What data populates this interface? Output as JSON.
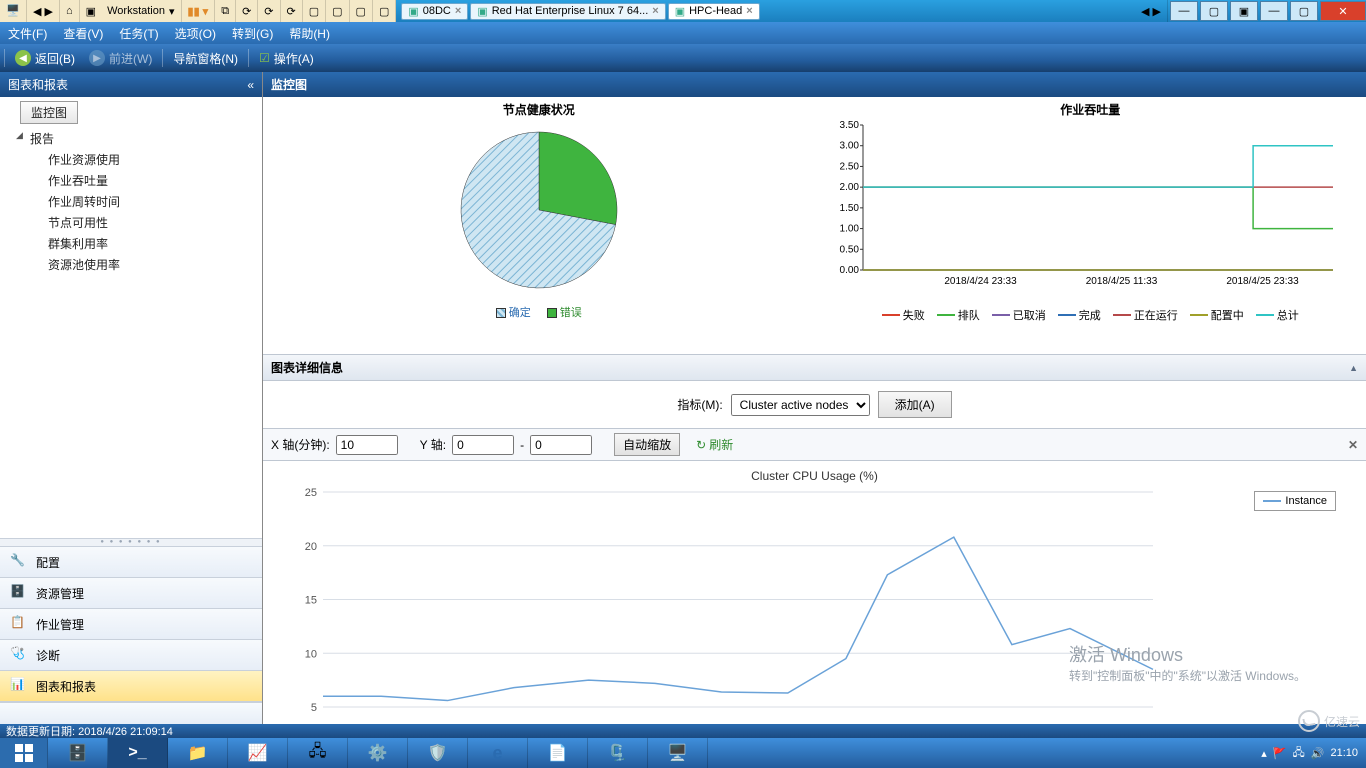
{
  "vm_bar": {
    "workstation_label": "Workstation",
    "tabs": [
      {
        "label": "08DC",
        "active": false
      },
      {
        "label": "Red Hat Enterprise Linux 7 64...",
        "active": false
      },
      {
        "label": "HPC-Head",
        "active": true
      }
    ]
  },
  "menubar": [
    "文件(F)",
    "查看(V)",
    "任务(T)",
    "选项(O)",
    "转到(G)",
    "帮助(H)"
  ],
  "navbar": {
    "back": "返回(B)",
    "forward": "前进(W)",
    "navpane": "导航窗格(N)",
    "ops": "操作(A)"
  },
  "sidebar": {
    "header": "图表和报表",
    "btn": "监控图",
    "tree_parent": "报告",
    "tree_items": [
      "作业资源使用",
      "作业吞吐量",
      "作业周转时间",
      "节点可用性",
      "群集利用率",
      "资源池使用率"
    ],
    "tabs": [
      "配置",
      "资源管理",
      "作业管理",
      "诊断",
      "图表和报表"
    ]
  },
  "main": {
    "header": "监控图",
    "detail_header": "图表详细信息",
    "metric_label": "指标(M):",
    "metric_select": "Cluster active nodes",
    "add_btn": "添加(A)",
    "xaxis_label": "X 轴(分钟):",
    "xaxis_val": "10",
    "yaxis_label": "Y 轴:",
    "yaxis_from": "0",
    "yaxis_to": "0",
    "auto_btn": "自动缩放",
    "refresh_btn": "刷新"
  },
  "statusbar": "数据更新日期: 2018/4/26 21:09:14",
  "taskbar_time": "21:10",
  "watermark": {
    "line1": "激活 Windows",
    "line2": "转到\"控制面板\"中的\"系统\"以激活 Windows。"
  },
  "yisu": "亿速云",
  "chart_data": [
    {
      "type": "pie",
      "title": "节点健康状况",
      "series": [
        {
          "name": "确定",
          "value": 72,
          "color": "#a6d3e8",
          "pattern": "hatch"
        },
        {
          "name": "错误",
          "value": 28,
          "color": "#3fb43f"
        }
      ]
    },
    {
      "type": "line",
      "title": "作业吞吐量",
      "ylim": [
        0,
        3.5
      ],
      "yticks": [
        0,
        0.5,
        1.0,
        1.5,
        2.0,
        2.5,
        3.0,
        3.5
      ],
      "x_categories": [
        "2018/4/24 23:33",
        "2018/4/25 11:33",
        "2018/4/25 23:33"
      ],
      "series": [
        {
          "name": "失败",
          "color": "#d9402b",
          "segments": [
            [
              0,
              0
            ],
            [
              0.83,
              0
            ],
            [
              0.83,
              0
            ],
            [
              1,
              0
            ]
          ]
        },
        {
          "name": "排队",
          "color": "#3fb43f",
          "segments": [
            [
              0,
              2
            ],
            [
              0.83,
              2
            ],
            [
              0.83,
              1
            ],
            [
              1,
              1
            ]
          ]
        },
        {
          "name": "已取消",
          "color": "#7a5fa8",
          "segments": [
            [
              0,
              0
            ],
            [
              0.83,
              0
            ],
            [
              0.83,
              0
            ],
            [
              1,
              0
            ]
          ]
        },
        {
          "name": "完成",
          "color": "#2f6fb5",
          "segments": [
            [
              0,
              0
            ],
            [
              0.83,
              0
            ],
            [
              0.83,
              0
            ],
            [
              1,
              0
            ]
          ]
        },
        {
          "name": "正在运行",
          "color": "#b5494a",
          "segments": [
            [
              0,
              2
            ],
            [
              0.83,
              2
            ],
            [
              0.83,
              2
            ],
            [
              1,
              2
            ]
          ]
        },
        {
          "name": "配置中",
          "color": "#a0a02a",
          "segments": [
            [
              0,
              0
            ],
            [
              0.83,
              0
            ],
            [
              0.83,
              0
            ],
            [
              1,
              0
            ]
          ]
        },
        {
          "name": "总计",
          "color": "#2fc4c4",
          "segments": [
            [
              0,
              2
            ],
            [
              0.83,
              2
            ],
            [
              0.83,
              3
            ],
            [
              1,
              3
            ]
          ]
        }
      ]
    },
    {
      "type": "line",
      "title": "Cluster CPU Usage (%)",
      "ylim": [
        5,
        25
      ],
      "yticks": [
        5,
        10,
        15,
        20,
        25
      ],
      "x": [
        0,
        0.07,
        0.15,
        0.23,
        0.32,
        0.4,
        0.48,
        0.56,
        0.63,
        0.68,
        0.76,
        0.83,
        0.9,
        1.0
      ],
      "series": [
        {
          "name": "Instance",
          "color": "#6aa2d8",
          "values": [
            6.0,
            6.0,
            5.6,
            6.8,
            7.5,
            7.2,
            6.4,
            6.3,
            9.5,
            17.3,
            20.8,
            10.8,
            12.3,
            8.5
          ]
        }
      ]
    }
  ]
}
